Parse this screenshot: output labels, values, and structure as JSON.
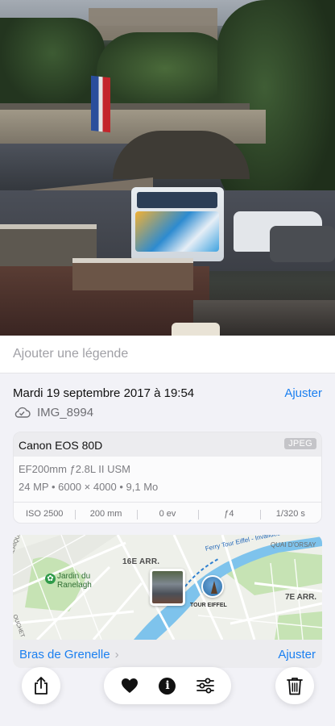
{
  "caption": {
    "placeholder": "Ajouter une légende"
  },
  "info": {
    "date": "Mardi 19 septembre 2017 à 19:54",
    "adjust_label": "Ajuster",
    "filename": "IMG_8994",
    "cloud_icon": "icloud-icon"
  },
  "camera": {
    "model": "Canon EOS 80D",
    "format_badge": "JPEG",
    "lens": "EF200mm ƒ2.8L II USM",
    "specs": "24 MP • 6000 × 4000 • 9,1 Mo",
    "exif": [
      "ISO 2500",
      "200 mm",
      "0 ev",
      "ƒ4",
      "1/320 s"
    ]
  },
  "map": {
    "labels": {
      "arr16": "16E ARR.",
      "arr7": "7E ARR.",
      "jardin_line1": "Jardin du",
      "jardin_line2": "Ranelagh",
      "quai": "QUAI D'ORSAY",
      "ferry": "Ferry Tour Eiffel - Invalides",
      "tour": "TOUR EIFFEL",
      "amerique": "AMÉRIQUE-INTE",
      "ouchet": "OUCHET"
    },
    "place": "Bras de Grenelle",
    "adjust_label": "Ajuster",
    "colors": {
      "water": "#7ec3ec",
      "park": "#c6e3b4",
      "road": "#ffffff",
      "accent": "#1a7ff0"
    }
  },
  "toolbar": {
    "share_icon": "share-icon",
    "favorite_icon": "heart-icon",
    "info_icon": "info-icon",
    "info_glyph": "i",
    "edit_icon": "sliders-icon",
    "delete_icon": "trash-icon"
  }
}
